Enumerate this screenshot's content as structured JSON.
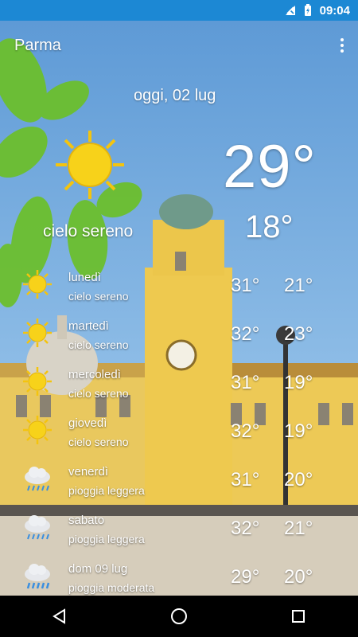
{
  "status_bar": {
    "time": "09:04"
  },
  "app_bar": {
    "city": "Parma"
  },
  "today": {
    "date": "oggi, 02 lug",
    "temp_max": "29°",
    "temp_min": "18°",
    "condition": "cielo sereno",
    "icon": "sun-icon"
  },
  "forecast": [
    {
      "day": "lunedì",
      "desc": "cielo sereno",
      "max": "31°",
      "min": "21°",
      "icon": "sun-icon"
    },
    {
      "day": "martedì",
      "desc": "cielo sereno",
      "max": "32°",
      "min": "23°",
      "icon": "sun-icon"
    },
    {
      "day": "mercoledì",
      "desc": "cielo sereno",
      "max": "31°",
      "min": "19°",
      "icon": "sun-icon"
    },
    {
      "day": "giovedì",
      "desc": "cielo sereno",
      "max": "32°",
      "min": "19°",
      "icon": "sun-icon"
    },
    {
      "day": "venerdì",
      "desc": "pioggia leggera",
      "max": "31°",
      "min": "20°",
      "icon": "rain-cloud-icon"
    },
    {
      "day": "sabato",
      "desc": "pioggia leggera",
      "max": "32°",
      "min": "21°",
      "icon": "rain-cloud-icon"
    },
    {
      "day": "dom 09 lug",
      "desc": "pioggia moderata",
      "max": "29°",
      "min": "20°",
      "icon": "rain-cloud-icon"
    }
  ],
  "colors": {
    "status_bar": "#1c88d4",
    "sun": "#f7d21a",
    "nav_bar": "#000000"
  }
}
